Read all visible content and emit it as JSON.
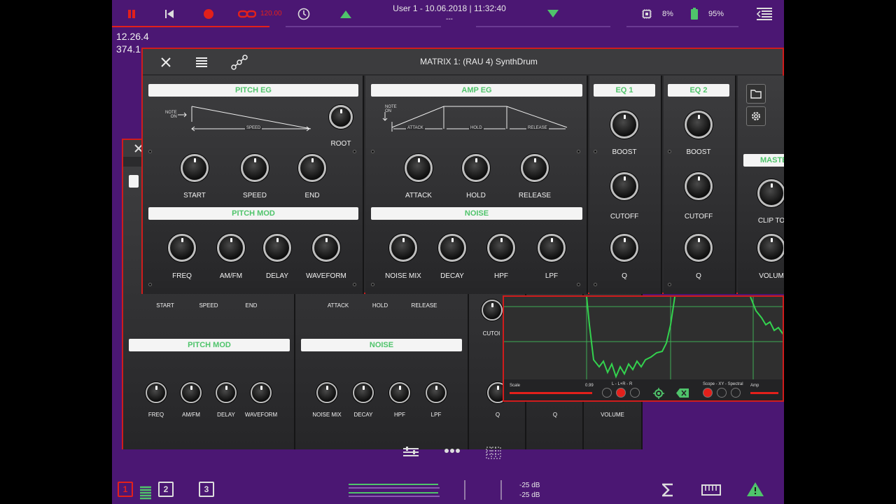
{
  "topbar": {
    "tempo": "120.00",
    "session_title": "User 1 - 10.06.2018 | 11:32:40",
    "session_sub": "---",
    "cpu": "8%",
    "battery": "95%",
    "icons": [
      "pause-icon",
      "skip-back-icon",
      "record-icon",
      "link-icon",
      "clock-icon",
      "arrow-up-icon",
      "arrow-down-icon",
      "cpu-icon",
      "battery-icon",
      "list-icon"
    ],
    "accent": "#e3201b"
  },
  "readouts": {
    "line1": "12.26.4",
    "line2": "374.1"
  },
  "front": {
    "title": "MATRIX 1: (RAU 4) SynthDrum",
    "pitch_eg": {
      "header": "PITCH EG",
      "note_on": "NOTE\nON",
      "speed": "SPEED",
      "root": "ROOT",
      "knobs": [
        "START",
        "SPEED",
        "END"
      ]
    },
    "amp_eg": {
      "header": "AMP EG",
      "note_on": "NOTE\nON",
      "stages": [
        "ATTACK",
        "HOLD",
        "RELEASE"
      ],
      "knobs": [
        "ATTACK",
        "HOLD",
        "RELEASE"
      ]
    },
    "pitch_mod": {
      "header": "PITCH MOD",
      "knobs": [
        "FREQ",
        "AM/FM",
        "DELAY",
        "WAVEFORM"
      ]
    },
    "noise": {
      "header": "NOISE",
      "knobs": [
        "NOISE MIX",
        "DECAY",
        "HPF",
        "LPF"
      ]
    },
    "eq1": {
      "header": "EQ 1",
      "knobs": [
        "BOOST",
        "CUTOFF",
        "Q"
      ]
    },
    "eq2": {
      "header": "EQ 2",
      "knobs": [
        "BOOST",
        "CUTOFF",
        "Q"
      ]
    },
    "master": {
      "header": "MASTE",
      "knobs": [
        "CLIP TO",
        "VOLUM"
      ]
    }
  },
  "back": {
    "eg_labels": [
      "START",
      "SPEED",
      "END",
      "ATTACK",
      "HOLD",
      "RELEASE",
      "CUTOI"
    ],
    "pitch_mod": {
      "header": "PITCH MOD",
      "knobs": [
        "FREQ",
        "AM/FM",
        "DELAY",
        "WAVEFORM"
      ]
    },
    "noise": {
      "header": "NOISE",
      "knobs": [
        "NOISE MIX",
        "DECAY",
        "HPF",
        "LPF"
      ]
    },
    "eq_labels": [
      "Q",
      "Q",
      "VOLUME"
    ]
  },
  "scope": {
    "scale_label": "Scale",
    "scale_value": "0.99",
    "channel_label": "L - L+R - R",
    "mode_label": "Scope - XY - Spectral",
    "amp_label": "Amp"
  },
  "bottombar": {
    "meter_top": "-25 dB",
    "meter_bottom": "-25 dB",
    "tabs": [
      "1",
      "2",
      "3"
    ]
  }
}
